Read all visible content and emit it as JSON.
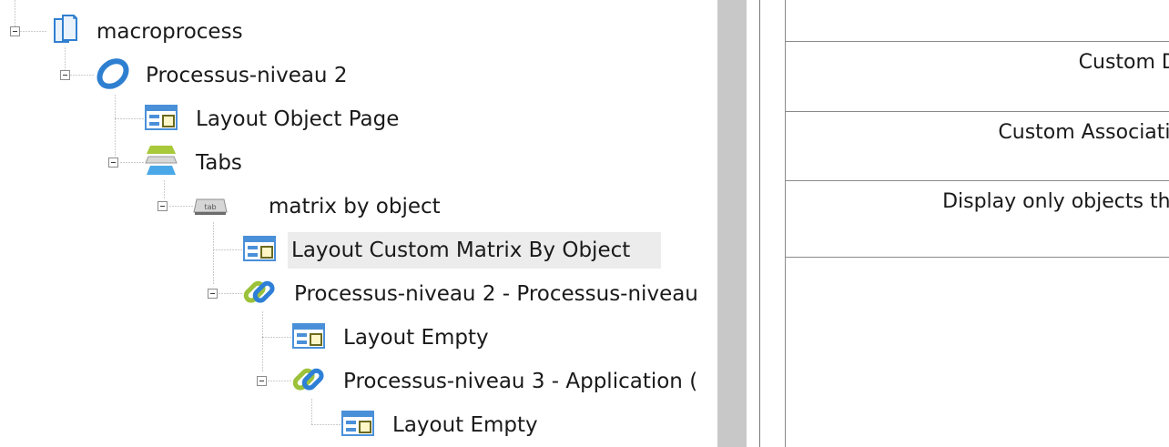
{
  "tree": {
    "nodes": [
      {
        "label": "macroprocess",
        "icon": "macroprocess-icon"
      },
      {
        "label": "Processus-niveau 2",
        "icon": "process-ring-icon"
      },
      {
        "label": "Layout Object Page",
        "icon": "layout-icon"
      },
      {
        "label": "Tabs",
        "icon": "tabs-icon"
      },
      {
        "label": "matrix by object",
        "icon": "tab-icon",
        "icon_text": "tab"
      },
      {
        "label": "Layout Custom Matrix By Object",
        "icon": "layout-icon"
      },
      {
        "label": "Processus-niveau 2 - Processus-niveau",
        "icon": "link-icon"
      },
      {
        "label": "Layout Empty",
        "icon": "layout-icon"
      },
      {
        "label": "Processus-niveau 3 - Application (",
        "icon": "link-icon"
      },
      {
        "label": "Layout Empty",
        "icon": "layout-icon"
      }
    ],
    "selected_index": 5
  },
  "properties": {
    "rows": [
      {
        "text": ""
      },
      {
        "text": "Custom Di"
      },
      {
        "text": "Custom Associatio"
      },
      {
        "text": "Display only objects tha"
      },
      {
        "text": ""
      }
    ]
  },
  "colors": {
    "layout_blue": "#4a90d9",
    "layout_olive": "#6b6a1e",
    "link_green": "#9cc23a",
    "link_blue": "#2e7fd6",
    "tabs_green": "#a8c93a",
    "tabs_blue": "#4aa8e8",
    "tree_line": "#9a9a9a",
    "selected_bg": "#ececec",
    "splitter": "#c8c8c8"
  }
}
